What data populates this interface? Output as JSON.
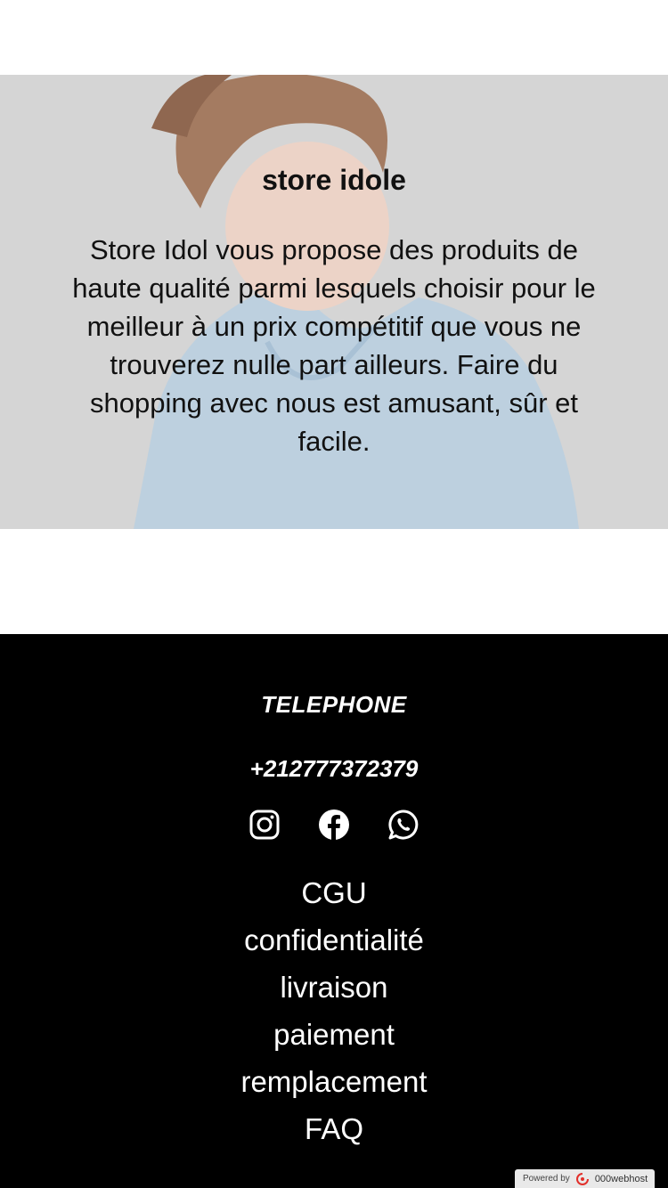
{
  "hero": {
    "title": "store idole",
    "description": "Store Idol vous propose des produits de haute qualité parmi lesquels choisir pour le meilleur à un prix compétitif que vous ne trouverez nulle part ailleurs. Faire du shopping avec nous est amusant, sûr et facile.",
    "background_color": "#d5d5d5"
  },
  "footer": {
    "contact_label": "TELEPHONE",
    "phone": "+212777372379",
    "social": [
      "instagram-icon",
      "facebook-icon",
      "whatsapp-icon"
    ],
    "links": [
      "CGU",
      "confidentialité",
      "livraison",
      "paiement",
      "remplacement",
      "FAQ"
    ],
    "background_color": "#000000"
  },
  "badge": {
    "powered_by": "Powered by",
    "brand": "000webhost"
  }
}
